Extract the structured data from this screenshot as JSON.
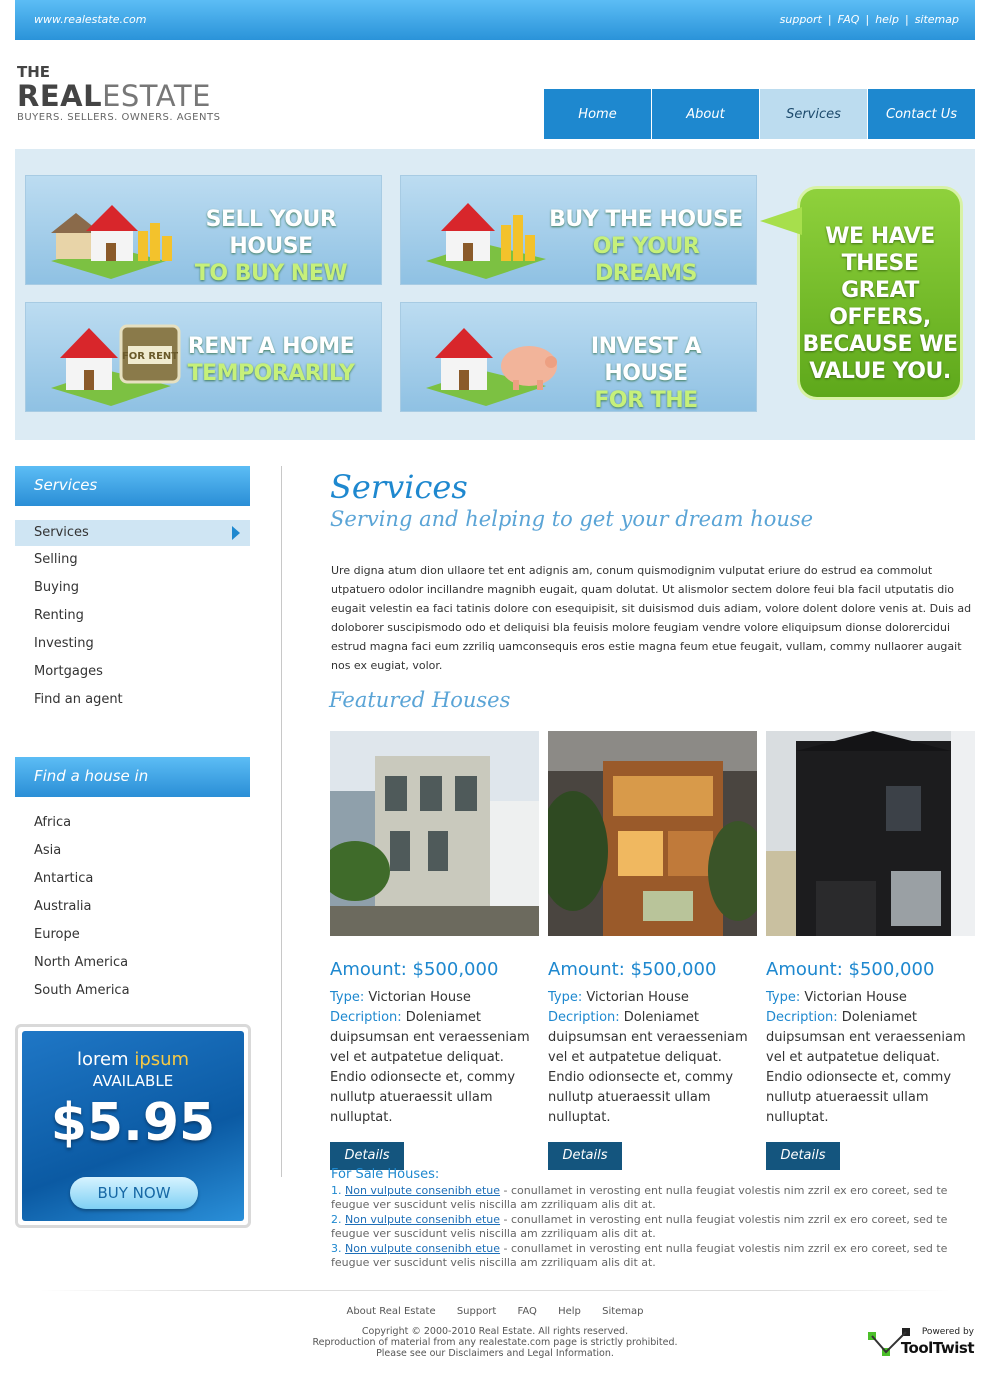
{
  "topbar": {
    "url": "www.realestate.com",
    "links": [
      "support",
      "FAQ",
      "help",
      "sitemap"
    ]
  },
  "logo": {
    "the": "THE",
    "real": "REAL",
    "estate": "ESTATE",
    "tagline": "BUYERS. SELLERS. OWNERS. AGENTS"
  },
  "nav": {
    "items": [
      "Home",
      "About",
      "Services",
      "Contact Us"
    ],
    "active": "Services"
  },
  "banner": {
    "promos": [
      {
        "line1": "SELL YOUR HOUSE",
        "line2": "TO BUY NEW ONE"
      },
      {
        "line1": "BUY THE HOUSE",
        "line2": "OF YOUR DREAMS"
      },
      {
        "line1": "RENT A HOME",
        "line2": "TEMPORARILY"
      },
      {
        "line1": "INVEST A HOUSE",
        "line2": "FOR THE FUTURE"
      }
    ],
    "sign_text": "FOR RENT",
    "bubble": "WE HAVE THESE GREAT OFFERS, BECAUSE WE VALUE YOU."
  },
  "sidebar": {
    "services_title": "Services",
    "services_items": [
      "Services",
      "Selling",
      "Buying",
      "Renting",
      "Investing",
      "Mortgages",
      "Find an agent"
    ],
    "find_title": "Find a house in",
    "find_items": [
      "Africa",
      "Asia",
      "Antartica",
      "Australia",
      "Europe",
      "North America",
      "South America"
    ]
  },
  "ad": {
    "lorem": "lorem",
    "ipsum": "ipsum",
    "available": "AVAILABLE",
    "price": "$5.95",
    "buy": "BUY NOW"
  },
  "main": {
    "title": "Services",
    "subtitle": "Serving and helping to get your dream house",
    "intro": "Ure digna atum dion ullaore tet ent adignis am, conum quismodignim vulputat eriure do estrud ea commolut utpatuero odolor incillandre magnibh eugait, quam dolutat. Ut alismolor sectem dolore feui bla facil utputatis dio eugait velestin ea faci tatinis dolore con esequipisit, sit duisismod duis adiam, volore dolent dolore venis at. Duis ad doloborer suscipismodo odo et deliquisi bla feuisis molore feugiam vendre volore eliquipsum dionse dolorercidui estrud magna faci eum zzriliq uamconsequis eros estie magna feum etue feugait, vullam, commy nullaorer augait nos ex eugiat, volor.",
    "featured_title": "Featured Houses",
    "houses": [
      {
        "amount": "Amount: $500,000",
        "type_label": "Type:",
        "type": "Victorian House",
        "desc_label": "Decription:",
        "desc": "Doleniamet duipsumsan ent veraesseniam vel et autpatetue deliquat. Endio odionsecte et, commy nullutp atueraessit ullam nulluptat.",
        "button": "Details"
      },
      {
        "amount": "Amount: $500,000",
        "type_label": "Type:",
        "type": "Victorian House",
        "desc_label": "Decription:",
        "desc": "Doleniamet duipsumsan ent veraesseniam vel et autpatetue deliquat. Endio odionsecte et, commy nullutp atueraessit ullam nulluptat.",
        "button": "Details"
      },
      {
        "amount": "Amount: $500,000",
        "type_label": "Type:",
        "type": "Victorian House",
        "desc_label": "Decription:",
        "desc": "Doleniamet duipsumsan ent veraesseniam vel et autpatetue deliquat. Endio odionsecte et, commy nullutp atueraessit ullam nulluptat.",
        "button": "Details"
      }
    ],
    "for_sale": {
      "title": "For Sale Houses:",
      "items": [
        {
          "num": "1.",
          "link": "Non vulpute consenibh etue",
          "text": " - conullamet in verosting ent nulla feugiat volestis nim zzril ex ero coreet, sed te feugue ver suscidunt velis niscilla am zzriliquam alis dit at."
        },
        {
          "num": "2.",
          "link": "Non vulpute consenibh etue",
          "text": " - conullamet in verosting ent nulla feugiat volestis nim zzril ex ero coreet, sed te feugue ver suscidunt velis niscilla am zzriliquam alis dit at."
        },
        {
          "num": "3.",
          "link": "Non vulpute consenibh etue",
          "text": " - conullamet in verosting ent nulla feugiat volestis nim zzril ex ero coreet, sed te feugue ver suscidunt velis niscilla am zzriliquam alis dit at."
        }
      ]
    }
  },
  "footer": {
    "links": [
      "About Real Estate",
      "Support",
      "FAQ",
      "Help",
      "Sitemap"
    ],
    "copy1": "Copyright © 2000-2010 Real Estate. All rights reserved.",
    "copy2": "Reproduction of material from any realestate.com page is strictly prohibited.",
    "copy3": "Please see our Disclaimers and Legal Information.",
    "powered_by": "Powered by",
    "brand": "ToolTwist"
  },
  "colors": {
    "accent": "#1e88cf",
    "nav_active": "#bcdcef",
    "bubble_green": "#6fb82a",
    "button_dark": "#14557e"
  }
}
